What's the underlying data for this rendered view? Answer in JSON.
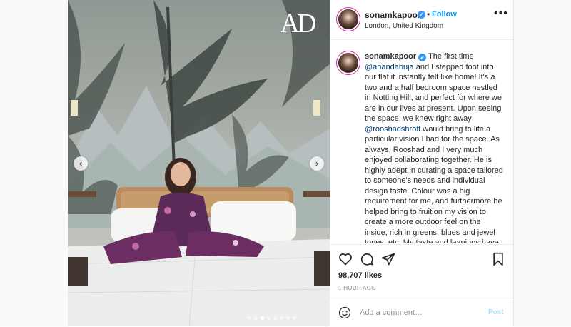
{
  "photo": {
    "logo_text": "AD",
    "carousel_dot_count": 8,
    "active_dot": 3
  },
  "post_header": {
    "username": "sonamkapoor",
    "separator": "•",
    "follow_label": "Follow",
    "location": "London, United Kingdom",
    "more_label": "•••"
  },
  "caption": {
    "username": "sonamkapoor",
    "part1": "The first time",
    "mention1": "@anandahuja",
    "part2": "and I stepped foot into our flat it instantly felt like home! It's a two and a half bedroom space nestled in Notting Hill, and perfect for where we are in our lives at present. Upon seeing the space, we knew right away",
    "mention2": "@rooshadshroff",
    "part3": "would bring to life a particular vision I had for the space. As always, Rooshad and I very much enjoyed collaborating together. He is highly adept in curating a space tailored to someone's needs and individual design taste. Colour was a big requirement for me, and furthermore he helped bring to fruition my vision to create a more outdoor feel on the inside, rich in greens, blues and jewel tones, etc. My taste and leanings have become far"
  },
  "stats": {
    "likes": "98,707 likes",
    "time_ago": "1 HOUR AGO"
  },
  "comment": {
    "placeholder": "Add a comment…",
    "post_label": "Post"
  },
  "icons": {
    "like": "heart-icon",
    "comment": "comment-icon",
    "share": "share-icon",
    "save": "bookmark-icon",
    "emoji": "emoji-icon",
    "verified": "verified-badge-icon"
  },
  "colors": {
    "link_blue": "#0095f6",
    "mention": "#00376b",
    "verified": "#3897f0",
    "muted": "#8e8e8e"
  }
}
